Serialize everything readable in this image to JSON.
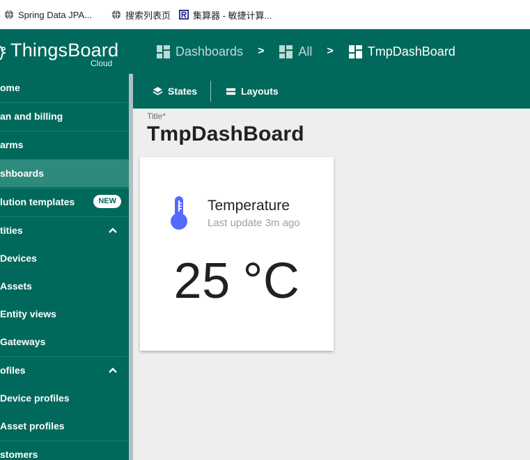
{
  "bookmarks": [
    {
      "label": "Spring Data JPA...",
      "icon": "globe-icon"
    },
    {
      "label": "搜索列表页",
      "icon": "globe-icon"
    },
    {
      "label": "集算器 - 敏捷计算...",
      "icon": "r-logo-icon"
    }
  ],
  "header": {
    "logo_name": "ThingsBoard",
    "logo_sub": "Cloud",
    "breadcrumbs": [
      {
        "label": "Dashboards",
        "icon": "dashboard-icon"
      },
      {
        "label": "All",
        "icon": "dashboard-icon"
      },
      {
        "label": "TmpDashBoard",
        "icon": "dashboard-icon"
      }
    ],
    "separator": ">"
  },
  "sidebar": {
    "items": [
      {
        "label": "ome"
      },
      {
        "label": "an and billing"
      },
      {
        "label": "arms"
      },
      {
        "label": "shboards",
        "selected": true
      },
      {
        "label": "lution templates",
        "badge": "NEW"
      },
      {
        "label": "tities",
        "expanded": true
      },
      {
        "label": "Devices"
      },
      {
        "label": "Assets"
      },
      {
        "label": "Entity views"
      },
      {
        "label": "Gateways"
      },
      {
        "label": "ofiles",
        "expanded": true
      },
      {
        "label": "Device profiles"
      },
      {
        "label": "Asset profiles"
      },
      {
        "label": "stomers"
      }
    ]
  },
  "toolbar": {
    "states_label": "States",
    "layouts_label": "Layouts"
  },
  "main": {
    "title_label": "Title*",
    "title_value": "TmpDashBoard"
  },
  "widget": {
    "title": "Temperature",
    "subtitle": "Last update 3m ago",
    "value": "25",
    "unit": "°C",
    "icon": "thermometer-icon",
    "icon_color": "#5469ff"
  },
  "colors": {
    "primary": "#00695c",
    "selected": "#2e8a7c"
  }
}
